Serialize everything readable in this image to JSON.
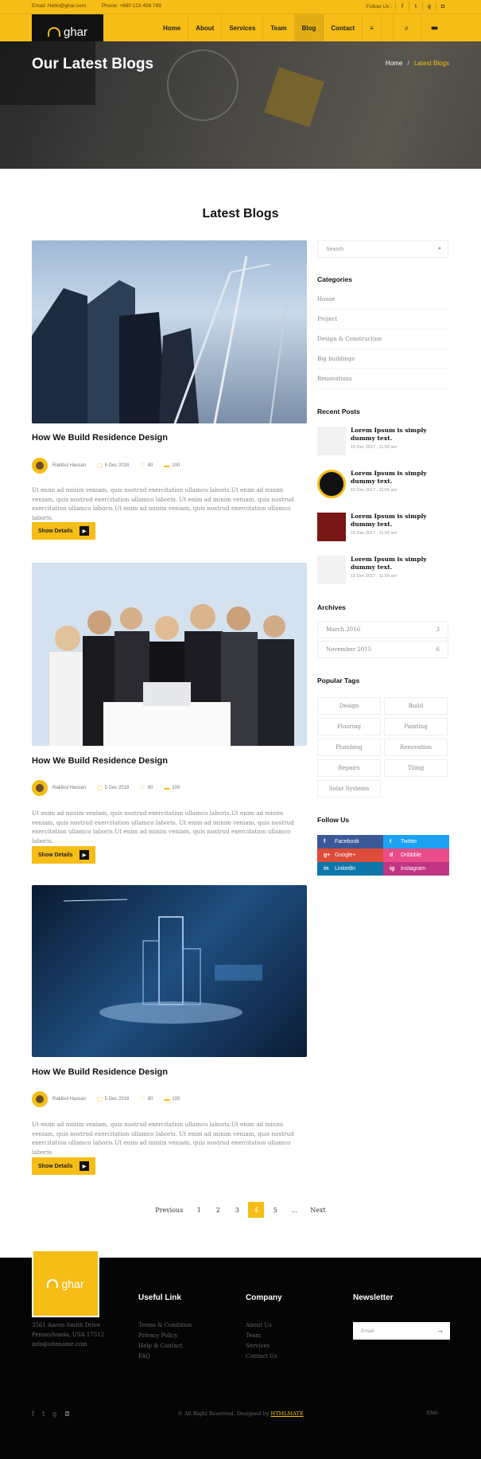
{
  "topbar": {
    "email": "Email: Hello@ghar.com",
    "phone": "Phone: +880 123 456 789",
    "follow_label": "Follow Us :",
    "social_icons": [
      "facebook-icon",
      "twitter-icon",
      "google-plus-icon",
      "instagram-icon"
    ]
  },
  "brand": {
    "name": "ghar"
  },
  "nav": {
    "items": [
      "Home",
      "About",
      "Services",
      "Team",
      "Blog",
      "Contact"
    ],
    "active": "Blog",
    "menu_icon": "menu-icon",
    "search_icon": "search-icon",
    "chat_icon": "chat-icon"
  },
  "hero": {
    "title": "Our Latest Blogs",
    "crumb_home": "Home",
    "crumb_sep": "/",
    "crumb_current": "Latest Blogs"
  },
  "section": {
    "title": "Latest Blogs"
  },
  "posts": [
    {
      "title": "How We Build Residence Design",
      "author": "Rakibul Hassan",
      "date": "5 Dec 2018",
      "likes": "80",
      "comments": "100",
      "excerpt": "Ut enim ad minim veniam, quis nostrud exercitation ullamco laboris.Ut enim ad minim veniam, quis nostrud exercitation ullamco laboris. Ut enim ad minim veniam, quis nostrud exercitation ullamco laboris.Ut enim ad minim veniam, quis nostrud exercitation ullamco laboris.",
      "button": "Show Details"
    },
    {
      "title": "How We Build Residence Design",
      "author": "Rakibul Hassan",
      "date": "5 Dec 2018",
      "likes": "80",
      "comments": "100",
      "excerpt": "Ut enim ad minim veniam, quis nostrud exercitation ullamco laboris.Ut enim ad minim veniam, quis nostrud exercitation ullamco laboris. Ut enim ad minim veniam, quis nostrud exercitation ullamco laboris.Ut enim ad minim veniam, quis nostrud exercitation ullamco laboris.",
      "button": "Show Details"
    },
    {
      "title": "How We Build Residence Design",
      "author": "Rakibul Hassan",
      "date": "5 Dec 2018",
      "likes": "80",
      "comments": "100",
      "excerpt": "Ut enim ad minim veniam, quis nostrud exercitation ullamco laboris.Ut enim ad minim veniam, quis nostrud exercitation ullamco laboris. Ut enim ad minim veniam, quis nostrud exercitation ullamco laboris.Ut enim ad minim veniam, quis nostrud exercitation ullamco laboris.",
      "button": "Show Details"
    }
  ],
  "pagination": {
    "prev": "Previous",
    "pages": [
      "1",
      "2",
      "3",
      "4",
      "5",
      "..."
    ],
    "current": "4",
    "next": "Next"
  },
  "sidebar": {
    "search_placeholder": "Search",
    "categories_title": "Categories",
    "categories": [
      "House",
      "Project",
      "Design & Construction",
      "Big buildings",
      "Renovations"
    ],
    "recent_title": "Recent Posts",
    "recent": [
      {
        "title": "Lorem Ipsum is simply dummy text.",
        "date": "19 Dec 2017 , 11:56 am"
      },
      {
        "title": "Lorem Ipsum is simply dummy text.",
        "date": "19 Dec 2017 , 11:56 am"
      },
      {
        "title": "Lorem Ipsum is simply dummy text.",
        "date": "19 Dec 2017 , 11:56 am"
      },
      {
        "title": "Lorem Ipsum is simply dummy text.",
        "date": "19 Dec 2017 , 11:56 am"
      }
    ],
    "archives_title": "Archives",
    "archives": [
      {
        "label": "March 2016",
        "count": "3"
      },
      {
        "label": "November 2015",
        "count": "6"
      }
    ],
    "tags_title": "Popular Tags",
    "tags": [
      "Design",
      "Build",
      "Flooring",
      "Painting",
      "Plumbing",
      "Renovation",
      "Repairs",
      "Tiling",
      "Solar Systems"
    ],
    "follow_title": "Follow Us",
    "social": [
      {
        "label": "Facebook",
        "icon": "f",
        "color": "#3b5998"
      },
      {
        "label": "Twitter",
        "icon": "t",
        "color": "#1da1f2"
      },
      {
        "label": "Google+",
        "icon": "g+",
        "color": "#dd4b39"
      },
      {
        "label": "Dribbble",
        "icon": "d",
        "color": "#ea4c89"
      },
      {
        "label": "Linkedin",
        "icon": "in",
        "color": "#0e76a8"
      },
      {
        "label": "Instagram",
        "icon": "ig",
        "color": "#c13584"
      }
    ]
  },
  "footer": {
    "brand": "ghar",
    "address": [
      "3561 Aaron Smith Drive",
      "Pennsylvania, USA 17512",
      "info@sitename.com"
    ],
    "useful_title": "Useful Link",
    "useful": [
      "Terms & Condition",
      "Privacy Policy",
      "Help & Contact",
      "FAQ"
    ],
    "company_title": "Company",
    "company": [
      "About Us",
      "Team",
      "Services",
      "Contact Us"
    ],
    "newsletter_title": "Newsletter",
    "newsletter_placeholder": "Email",
    "copyright_prefix": "© All Right Reserved. Designed by",
    "copyright_link": "HTMLMATE",
    "lang": "ENG"
  },
  "colors": {
    "accent": "#f6bd17",
    "footer_bg": "#050505"
  }
}
